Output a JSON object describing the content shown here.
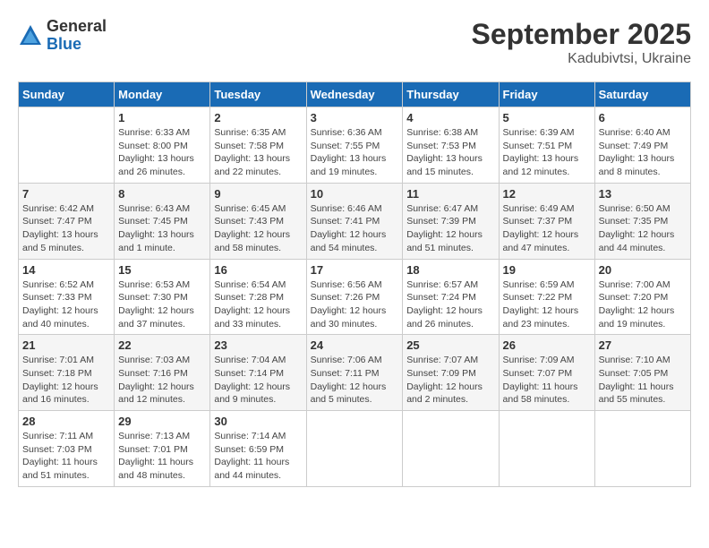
{
  "logo": {
    "general": "General",
    "blue": "Blue"
  },
  "header": {
    "month": "September 2025",
    "location": "Kadubivtsi, Ukraine"
  },
  "weekdays": [
    "Sunday",
    "Monday",
    "Tuesday",
    "Wednesday",
    "Thursday",
    "Friday",
    "Saturday"
  ],
  "weeks": [
    [
      {
        "day": "",
        "sunrise": "",
        "sunset": "",
        "daylight": ""
      },
      {
        "day": "1",
        "sunrise": "Sunrise: 6:33 AM",
        "sunset": "Sunset: 8:00 PM",
        "daylight": "Daylight: 13 hours and 26 minutes."
      },
      {
        "day": "2",
        "sunrise": "Sunrise: 6:35 AM",
        "sunset": "Sunset: 7:58 PM",
        "daylight": "Daylight: 13 hours and 22 minutes."
      },
      {
        "day": "3",
        "sunrise": "Sunrise: 6:36 AM",
        "sunset": "Sunset: 7:55 PM",
        "daylight": "Daylight: 13 hours and 19 minutes."
      },
      {
        "day": "4",
        "sunrise": "Sunrise: 6:38 AM",
        "sunset": "Sunset: 7:53 PM",
        "daylight": "Daylight: 13 hours and 15 minutes."
      },
      {
        "day": "5",
        "sunrise": "Sunrise: 6:39 AM",
        "sunset": "Sunset: 7:51 PM",
        "daylight": "Daylight: 13 hours and 12 minutes."
      },
      {
        "day": "6",
        "sunrise": "Sunrise: 6:40 AM",
        "sunset": "Sunset: 7:49 PM",
        "daylight": "Daylight: 13 hours and 8 minutes."
      }
    ],
    [
      {
        "day": "7",
        "sunrise": "Sunrise: 6:42 AM",
        "sunset": "Sunset: 7:47 PM",
        "daylight": "Daylight: 13 hours and 5 minutes."
      },
      {
        "day": "8",
        "sunrise": "Sunrise: 6:43 AM",
        "sunset": "Sunset: 7:45 PM",
        "daylight": "Daylight: 13 hours and 1 minute."
      },
      {
        "day": "9",
        "sunrise": "Sunrise: 6:45 AM",
        "sunset": "Sunset: 7:43 PM",
        "daylight": "Daylight: 12 hours and 58 minutes."
      },
      {
        "day": "10",
        "sunrise": "Sunrise: 6:46 AM",
        "sunset": "Sunset: 7:41 PM",
        "daylight": "Daylight: 12 hours and 54 minutes."
      },
      {
        "day": "11",
        "sunrise": "Sunrise: 6:47 AM",
        "sunset": "Sunset: 7:39 PM",
        "daylight": "Daylight: 12 hours and 51 minutes."
      },
      {
        "day": "12",
        "sunrise": "Sunrise: 6:49 AM",
        "sunset": "Sunset: 7:37 PM",
        "daylight": "Daylight: 12 hours and 47 minutes."
      },
      {
        "day": "13",
        "sunrise": "Sunrise: 6:50 AM",
        "sunset": "Sunset: 7:35 PM",
        "daylight": "Daylight: 12 hours and 44 minutes."
      }
    ],
    [
      {
        "day": "14",
        "sunrise": "Sunrise: 6:52 AM",
        "sunset": "Sunset: 7:33 PM",
        "daylight": "Daylight: 12 hours and 40 minutes."
      },
      {
        "day": "15",
        "sunrise": "Sunrise: 6:53 AM",
        "sunset": "Sunset: 7:30 PM",
        "daylight": "Daylight: 12 hours and 37 minutes."
      },
      {
        "day": "16",
        "sunrise": "Sunrise: 6:54 AM",
        "sunset": "Sunset: 7:28 PM",
        "daylight": "Daylight: 12 hours and 33 minutes."
      },
      {
        "day": "17",
        "sunrise": "Sunrise: 6:56 AM",
        "sunset": "Sunset: 7:26 PM",
        "daylight": "Daylight: 12 hours and 30 minutes."
      },
      {
        "day": "18",
        "sunrise": "Sunrise: 6:57 AM",
        "sunset": "Sunset: 7:24 PM",
        "daylight": "Daylight: 12 hours and 26 minutes."
      },
      {
        "day": "19",
        "sunrise": "Sunrise: 6:59 AM",
        "sunset": "Sunset: 7:22 PM",
        "daylight": "Daylight: 12 hours and 23 minutes."
      },
      {
        "day": "20",
        "sunrise": "Sunrise: 7:00 AM",
        "sunset": "Sunset: 7:20 PM",
        "daylight": "Daylight: 12 hours and 19 minutes."
      }
    ],
    [
      {
        "day": "21",
        "sunrise": "Sunrise: 7:01 AM",
        "sunset": "Sunset: 7:18 PM",
        "daylight": "Daylight: 12 hours and 16 minutes."
      },
      {
        "day": "22",
        "sunrise": "Sunrise: 7:03 AM",
        "sunset": "Sunset: 7:16 PM",
        "daylight": "Daylight: 12 hours and 12 minutes."
      },
      {
        "day": "23",
        "sunrise": "Sunrise: 7:04 AM",
        "sunset": "Sunset: 7:14 PM",
        "daylight": "Daylight: 12 hours and 9 minutes."
      },
      {
        "day": "24",
        "sunrise": "Sunrise: 7:06 AM",
        "sunset": "Sunset: 7:11 PM",
        "daylight": "Daylight: 12 hours and 5 minutes."
      },
      {
        "day": "25",
        "sunrise": "Sunrise: 7:07 AM",
        "sunset": "Sunset: 7:09 PM",
        "daylight": "Daylight: 12 hours and 2 minutes."
      },
      {
        "day": "26",
        "sunrise": "Sunrise: 7:09 AM",
        "sunset": "Sunset: 7:07 PM",
        "daylight": "Daylight: 11 hours and 58 minutes."
      },
      {
        "day": "27",
        "sunrise": "Sunrise: 7:10 AM",
        "sunset": "Sunset: 7:05 PM",
        "daylight": "Daylight: 11 hours and 55 minutes."
      }
    ],
    [
      {
        "day": "28",
        "sunrise": "Sunrise: 7:11 AM",
        "sunset": "Sunset: 7:03 PM",
        "daylight": "Daylight: 11 hours and 51 minutes."
      },
      {
        "day": "29",
        "sunrise": "Sunrise: 7:13 AM",
        "sunset": "Sunset: 7:01 PM",
        "daylight": "Daylight: 11 hours and 48 minutes."
      },
      {
        "day": "30",
        "sunrise": "Sunrise: 7:14 AM",
        "sunset": "Sunset: 6:59 PM",
        "daylight": "Daylight: 11 hours and 44 minutes."
      },
      {
        "day": "",
        "sunrise": "",
        "sunset": "",
        "daylight": ""
      },
      {
        "day": "",
        "sunrise": "",
        "sunset": "",
        "daylight": ""
      },
      {
        "day": "",
        "sunrise": "",
        "sunset": "",
        "daylight": ""
      },
      {
        "day": "",
        "sunrise": "",
        "sunset": "",
        "daylight": ""
      }
    ]
  ]
}
